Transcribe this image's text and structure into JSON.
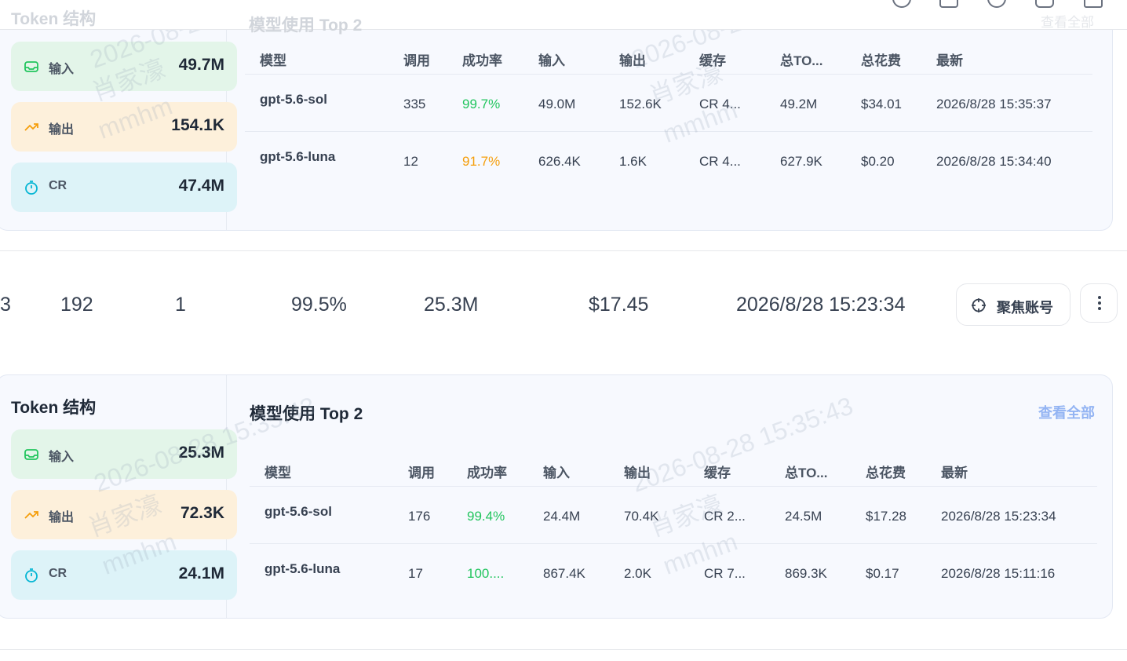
{
  "top_ghost": {
    "token_title": "Token 结构",
    "table_title": "模型使用 Top 2",
    "view_all": "查看全部"
  },
  "watermark": {
    "timestamp": "2026-08-28 15:35:43",
    "name": "肖家濠",
    "handle": "mmhm"
  },
  "headers": {
    "model": "模型",
    "calls": "调用",
    "success": "成功率",
    "input": "输入",
    "output": "输出",
    "cache": "缓存",
    "total_tokens": "总TO...",
    "total_cost": "总花费",
    "latest": "最新"
  },
  "panel_a": {
    "token_title": "Token 结构",
    "chips": {
      "input_label": "输入",
      "input_value": "49.7M",
      "output_label": "输出",
      "output_value": "154.1K",
      "cr_label": "CR",
      "cr_value": "47.4M"
    },
    "table_title": "模型使用 Top 2",
    "view_all": "查看全部",
    "rows": [
      {
        "model": "gpt-5.6-sol",
        "calls": "335",
        "success": "99.7%",
        "input": "49.0M",
        "output": "152.6K",
        "cache": "CR 4...",
        "total_tokens": "49.2M",
        "total_cost": "$34.01",
        "latest": "2026/8/28 15:35:37"
      },
      {
        "model": "gpt-5.6-luna",
        "calls": "12",
        "success": "91.7%",
        "input": "626.4K",
        "output": "1.6K",
        "cache": "CR 4...",
        "total_tokens": "627.9K",
        "total_cost": "$0.20",
        "latest": "2026/8/28 15:34:40"
      }
    ]
  },
  "account_row": {
    "c1": "3",
    "c2": "192",
    "c3": "1",
    "success": "99.5%",
    "tokens": "25.3M",
    "cost": "$17.45",
    "latest": "2026/8/28 15:23:34",
    "focus_label": "聚焦账号"
  },
  "panel_b": {
    "token_title": "Token 结构",
    "chips": {
      "input_label": "输入",
      "input_value": "25.3M",
      "output_label": "输出",
      "output_value": "72.3K",
      "cr_label": "CR",
      "cr_value": "24.1M"
    },
    "table_title": "模型使用 Top 2",
    "view_all": "查看全部",
    "rows": [
      {
        "model": "gpt-5.6-sol",
        "calls": "176",
        "success": "99.4%",
        "input": "24.4M",
        "output": "70.4K",
        "cache": "CR 2...",
        "total_tokens": "24.5M",
        "total_cost": "$17.28",
        "latest": "2026/8/28 15:23:34"
      },
      {
        "model": "gpt-5.6-luna",
        "calls": "17",
        "success": "100....",
        "input": "867.4K",
        "output": "2.0K",
        "cache": "CR 7...",
        "total_tokens": "869.3K",
        "total_cost": "$0.17",
        "latest": "2026/8/28 15:11:16"
      }
    ]
  },
  "colors": {
    "success_green": "#22c55e",
    "warning_orange": "#f59e0b",
    "link_blue": "#93b4f3",
    "input_chip": "#e3f5e9",
    "output_chip": "#fdf0db",
    "cr_chip": "#ddf3f8"
  },
  "icons": {
    "input": "inbox-icon",
    "output": "trending-up-icon",
    "cr": "timer-icon",
    "focus": "crosshair-icon",
    "more": "more-vertical-icon"
  }
}
